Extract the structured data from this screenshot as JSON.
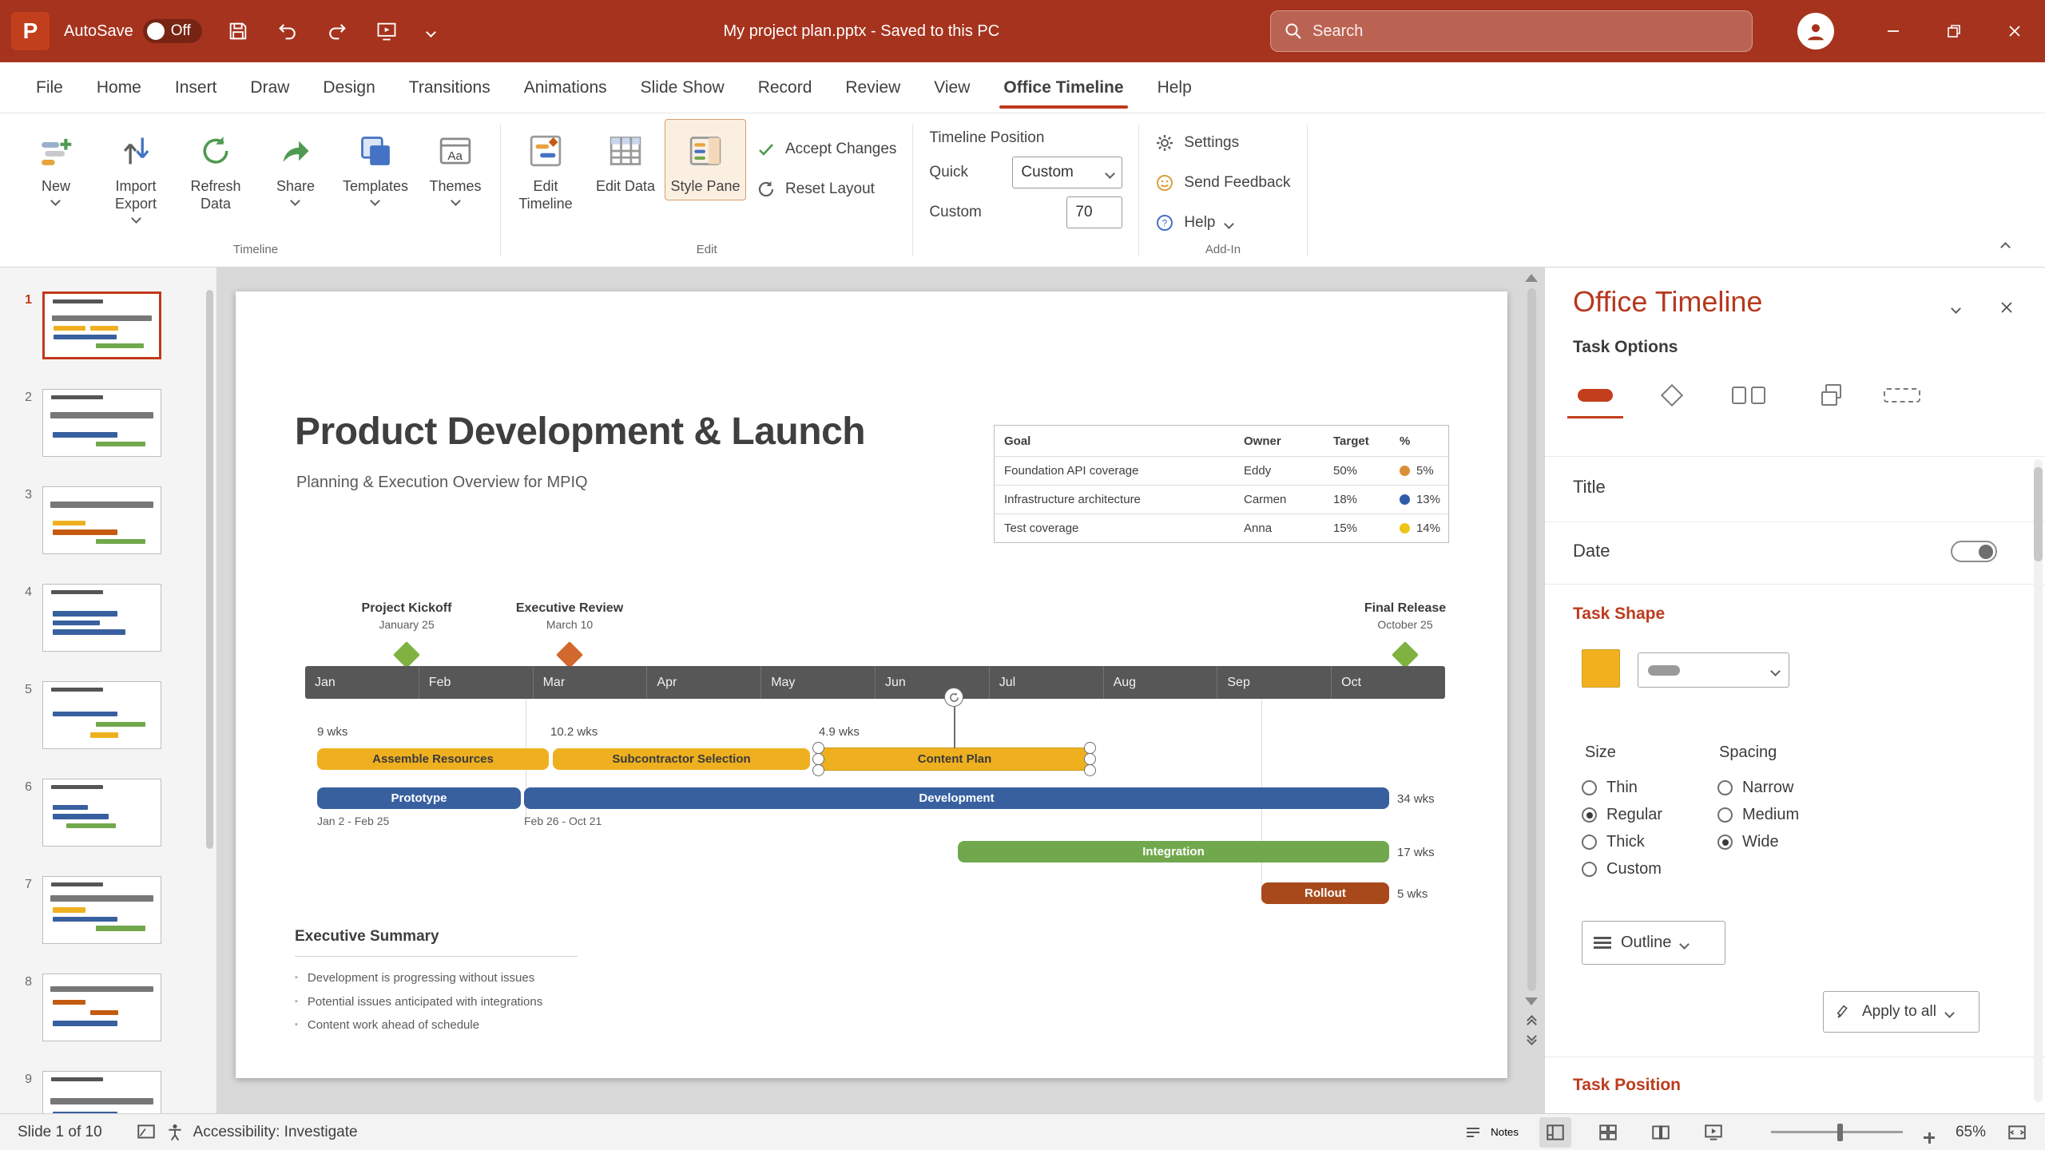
{
  "colors": {
    "accent": "#C0391B",
    "titlebar": "#A6331E",
    "timeline_band": "#575757"
  },
  "titlebar": {
    "app_initial": "P",
    "autosave_label": "AutoSave",
    "autosave_state": "Off",
    "document_title": "My project plan.pptx - Saved to this PC",
    "search_placeholder": "Search"
  },
  "tabs": {
    "items": [
      "File",
      "Home",
      "Insert",
      "Draw",
      "Design",
      "Transitions",
      "Animations",
      "Slide Show",
      "Record",
      "Review",
      "View",
      "Office Timeline",
      "Help"
    ],
    "active": "Office Timeline"
  },
  "ribbon": {
    "timeline_group": {
      "new": "New",
      "import_export": "Import Export",
      "refresh_data": "Refresh Data",
      "share": "Share",
      "templates": "Templates",
      "themes": "Themes",
      "label": "Timeline"
    },
    "edit_group": {
      "edit_timeline": "Edit Timeline",
      "edit_data": "Edit Data",
      "style_pane": "Style Pane",
      "accept_changes": "Accept Changes",
      "reset_layout": "Reset Layout",
      "label": "Edit"
    },
    "position_group": {
      "title": "Timeline Position",
      "quick_label": "Quick",
      "quick_value": "Custom",
      "custom_label": "Custom",
      "custom_value": "70"
    },
    "addin_group": {
      "settings": "Settings",
      "send_feedback": "Send Feedback",
      "help": "Help",
      "label": "Add-In"
    }
  },
  "thumbnails": {
    "numbers": [
      "1",
      "2",
      "3",
      "4",
      "5",
      "6",
      "7",
      "8",
      "9"
    ],
    "selected": "1"
  },
  "slide": {
    "title": "Product Development & Launch",
    "subtitle": "Planning & Execution Overview for MPIQ",
    "goal_table": {
      "headers": [
        "Goal",
        "Owner",
        "Target",
        "%"
      ],
      "rows": [
        {
          "goal": "Foundation API coverage",
          "owner": "Eddy",
          "target": "50%",
          "percent": "5%",
          "dot": "#DB8F35"
        },
        {
          "goal": "Infrastructure architecture",
          "owner": "Carmen",
          "target": "18%",
          "percent": "13%",
          "dot": "#2F5BA8"
        },
        {
          "goal": "Test coverage",
          "owner": "Anna",
          "target": "15%",
          "percent": "14%",
          "dot": "#EFC319"
        }
      ]
    },
    "months": [
      "Jan",
      "Feb",
      "Mar",
      "Apr",
      "May",
      "Jun",
      "Jul",
      "Aug",
      "Sep",
      "Oct"
    ],
    "milestones": [
      {
        "name": "Project Kickoff",
        "date": "January 25",
        "color": "#7FB240"
      },
      {
        "name": "Executive Review",
        "date": "March 10",
        "color": "#D2682D"
      },
      {
        "name": "Final Release",
        "date": "October 25",
        "color": "#7FB240"
      }
    ],
    "tasks": [
      {
        "name": "Assemble Resources",
        "duration": "9 wks",
        "color": "#EFB020"
      },
      {
        "name": "Subcontractor Selection",
        "duration": "10.2 wks",
        "color": "#EFB020"
      },
      {
        "name": "Content Plan",
        "duration": "4.9 wks",
        "color": "#EFB020",
        "selected": true
      },
      {
        "name": "Prototype",
        "dates": "Jan 2 - Feb 25",
        "color": "#38609F"
      },
      {
        "name": "Development",
        "dates": "Feb 26 - Oct 21",
        "duration": "34 wks",
        "color": "#38609F"
      },
      {
        "name": "Integration",
        "duration": "17 wks",
        "color": "#72A84D"
      },
      {
        "name": "Rollout",
        "duration": "5 wks",
        "color": "#A8491B"
      }
    ],
    "executive_summary": {
      "heading": "Executive Summary",
      "bullets": [
        "Development is progressing without issues",
        "Potential issues anticipated with integrations",
        "Content work ahead of schedule"
      ]
    }
  },
  "style_pane": {
    "title": "Office Timeline",
    "task_options": "Task Options",
    "sections": {
      "title_label": "Title",
      "date_label": "Date",
      "task_shape": "Task Shape",
      "size_label": "Size",
      "spacing_label": "Spacing",
      "outline_label": "Outline",
      "apply_to_all": "Apply to all",
      "task_position": "Task Position"
    },
    "size_options": [
      "Thin",
      "Regular",
      "Thick",
      "Custom"
    ],
    "size_selected": "Regular",
    "spacing_options": [
      "Narrow",
      "Medium",
      "Wide"
    ],
    "spacing_selected": "Wide",
    "swatch_color": "#F2B01E"
  },
  "statusbar": {
    "slide_indicator": "Slide 1 of 10",
    "accessibility": "Accessibility: Investigate",
    "notes": "Notes",
    "zoom": "65%"
  }
}
